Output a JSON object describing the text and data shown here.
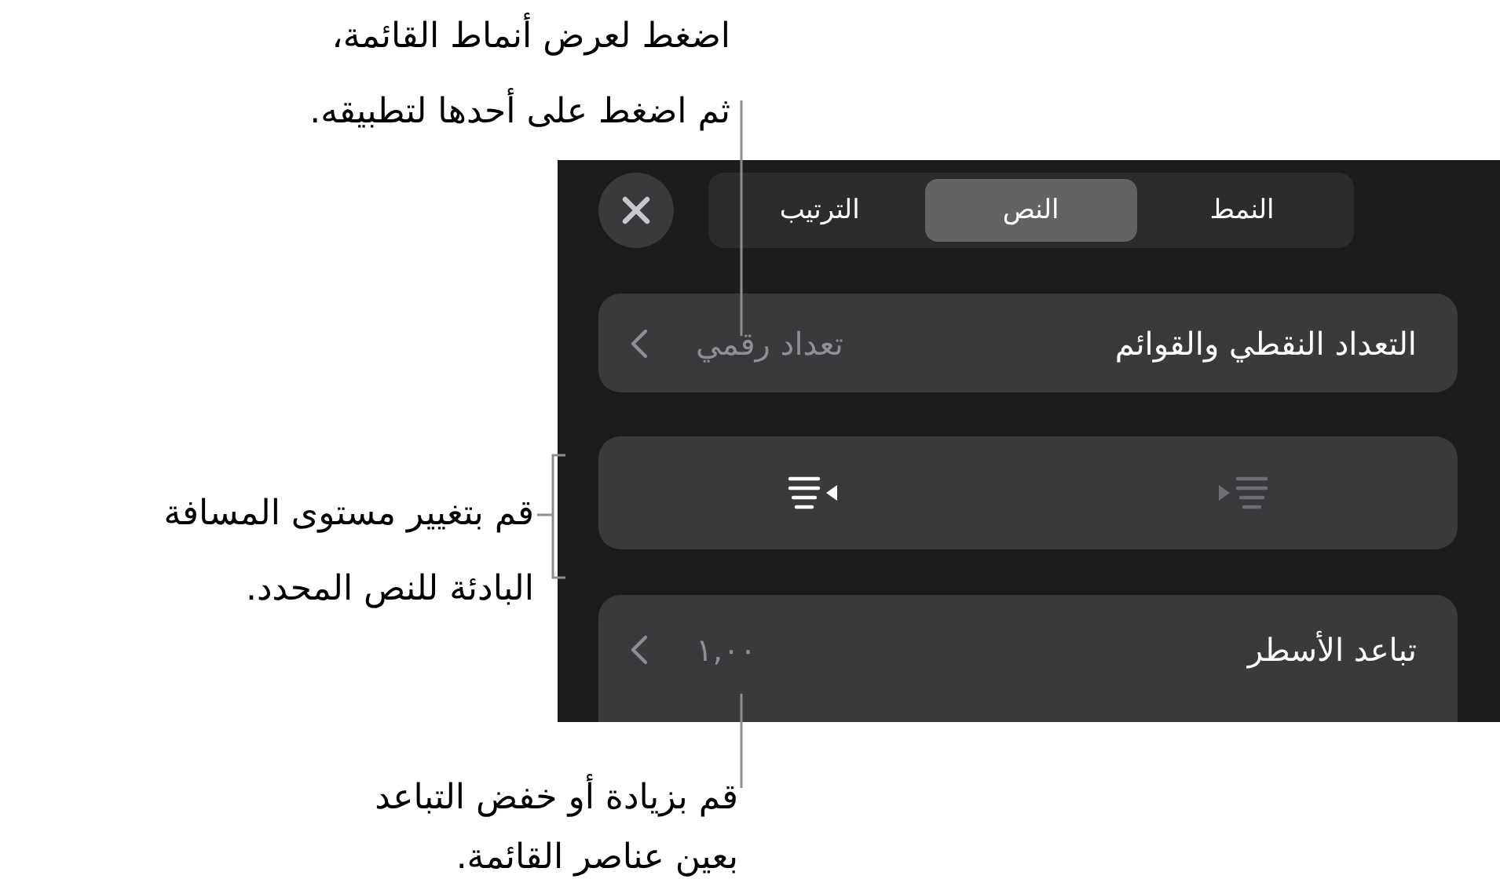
{
  "callouts": [
    {
      "lines": [
        "اضغط لعرض أنماط القائمة،",
        "ثم اضغط على أحدها لتطبيقه."
      ]
    },
    {
      "lines": [
        "قم بتغيير مستوى المسافة",
        "البادئة للنص المحدد."
      ]
    },
    {
      "lines": [
        "قم بزيادة أو خفض التباعد",
        "بعين عناصر القائمة."
      ]
    }
  ],
  "panel": {
    "tabs": [
      {
        "label": "النمط",
        "selected": false
      },
      {
        "label": "النص",
        "selected": true
      },
      {
        "label": "الترتيب",
        "selected": false
      }
    ],
    "list_style": {
      "label": "التعداد النقطي والقوائم",
      "value": "تعداد رقمي"
    },
    "indent_buttons": [
      {
        "kind": "increase",
        "disabled": true
      },
      {
        "kind": "decrease",
        "disabled": false
      }
    ],
    "line_spacing": {
      "label": "تباعد الأسطر",
      "value": "١,٠٠"
    }
  }
}
